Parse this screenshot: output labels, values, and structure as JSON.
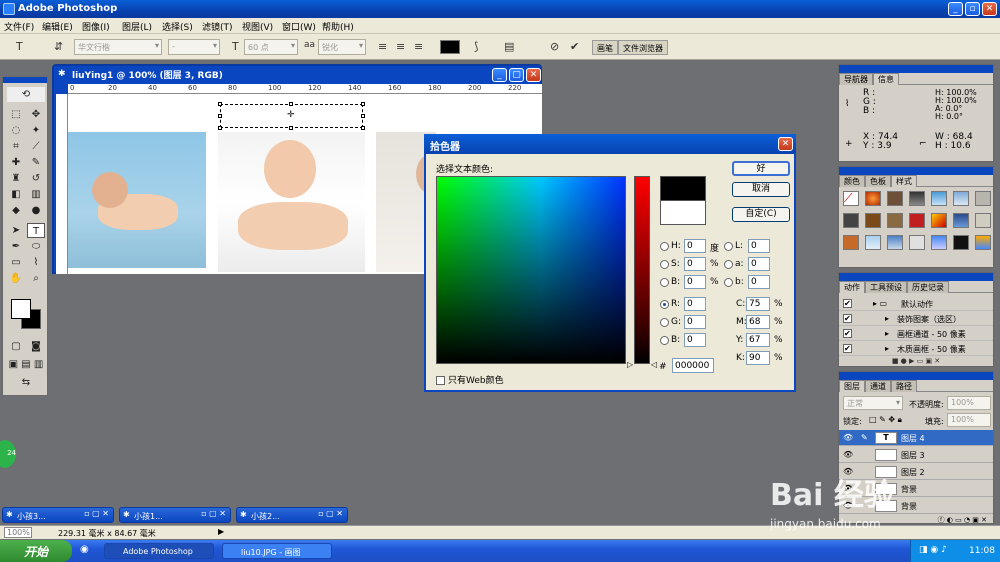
{
  "app": {
    "title": "Adobe Photoshop"
  },
  "menu": [
    "文件(F)",
    "编辑(E)",
    "图像(I)",
    "图层(L)",
    "选择(S)",
    "滤镜(T)",
    "视图(V)",
    "窗口(W)",
    "帮助(H)"
  ],
  "options": {
    "font_family": "华文行楷",
    "font_style": "-",
    "font_size": "60 点",
    "aa_label": "aa",
    "antialias": "锐化",
    "palette_tabs": [
      "画笔",
      "文件浏览器"
    ]
  },
  "document": {
    "title": "liuYing1 @ 100% (图层 3, RGB)",
    "ruler_ticks": [
      "0",
      "20",
      "40",
      "60",
      "80",
      "100",
      "120",
      "140",
      "160",
      "180",
      "200",
      "220"
    ]
  },
  "picker": {
    "title": "拾色器",
    "subtitle": "选择文本颜色:",
    "buttons": {
      "ok": "好",
      "cancel": "取消",
      "custom": "自定(C)"
    },
    "hsb": [
      {
        "label": "H:",
        "value": "0",
        "unit": "度",
        "checked": false
      },
      {
        "label": "S:",
        "value": "0",
        "unit": "%",
        "checked": false
      },
      {
        "label": "B:",
        "value": "0",
        "unit": "%",
        "checked": false
      }
    ],
    "rgb": [
      {
        "label": "R:",
        "value": "0",
        "checked": true
      },
      {
        "label": "G:",
        "value": "0",
        "checked": false
      },
      {
        "label": "B:",
        "value": "0",
        "checked": false
      }
    ],
    "lab": [
      {
        "label": "L:",
        "value": "0"
      },
      {
        "label": "a:",
        "value": "0"
      },
      {
        "label": "b:",
        "value": "0"
      }
    ],
    "cmyk": [
      {
        "label": "C:",
        "value": "75",
        "unit": "%"
      },
      {
        "label": "M:",
        "value": "68",
        "unit": "%"
      },
      {
        "label": "Y:",
        "value": "67",
        "unit": "%"
      },
      {
        "label": "K:",
        "value": "90",
        "unit": "%"
      }
    ],
    "hex_label": "#",
    "hex": "000000",
    "web_only": "只有Web颜色",
    "current_color": "#000000",
    "previous_color": "#ffffff"
  },
  "navigator": {
    "tabs": [
      "导航器",
      "信息"
    ],
    "rgb_labels": [
      "R :",
      "G :",
      "B :"
    ],
    "hsb_values": [
      "H:",
      "100.0%",
      "H:",
      "100.0%",
      "A:",
      "0.0°",
      "H:",
      "0.0°"
    ],
    "x_label": "X :",
    "x_value": "74.4",
    "y_label": "Y :",
    "y_value": "3.9",
    "w_label": "W :",
    "w_value": "68.4",
    "h_label": "H :",
    "h_value": "10.6"
  },
  "swatches": {
    "tabs": [
      "颜色",
      "色板",
      "样式"
    ]
  },
  "actions": {
    "tabs": [
      "动作",
      "工具预设",
      "历史记录"
    ],
    "items": [
      "默认动作",
      "装饰图案（选区）",
      "画框通道 - 50 像素",
      "木质画框 - 50 像素"
    ]
  },
  "layers": {
    "tabs": [
      "图层",
      "通道",
      "路径"
    ],
    "blend_mode": "正常",
    "opacity_label": "不透明度:",
    "opacity": "100%",
    "lock_label": "锁定:",
    "fill_label": "填充:",
    "fill": "100%",
    "items": [
      {
        "name": "图层 4",
        "thumb": "T",
        "selected": true
      },
      {
        "name": "图层 3",
        "thumb": "",
        "selected": false
      },
      {
        "name": "图层 2",
        "thumb": "",
        "selected": false
      },
      {
        "name": "背景",
        "thumb": "",
        "selected": false
      },
      {
        "name": "背景",
        "thumb": "",
        "selected": false
      }
    ]
  },
  "minimized_docs": [
    "小孩3...",
    "小孩1...",
    "小孩2..."
  ],
  "status": {
    "zoom": "100%",
    "doc_size": "229.31 毫米 x 84.67 毫米"
  },
  "taskbar": {
    "start": "开始",
    "items": [
      "Adobe Photoshop",
      "liu10.JPG - 画图"
    ],
    "time": "11:08"
  },
  "badge": "24",
  "watermark": {
    "main": "Bai 经验",
    "url": "jingyan.baidu.com"
  }
}
